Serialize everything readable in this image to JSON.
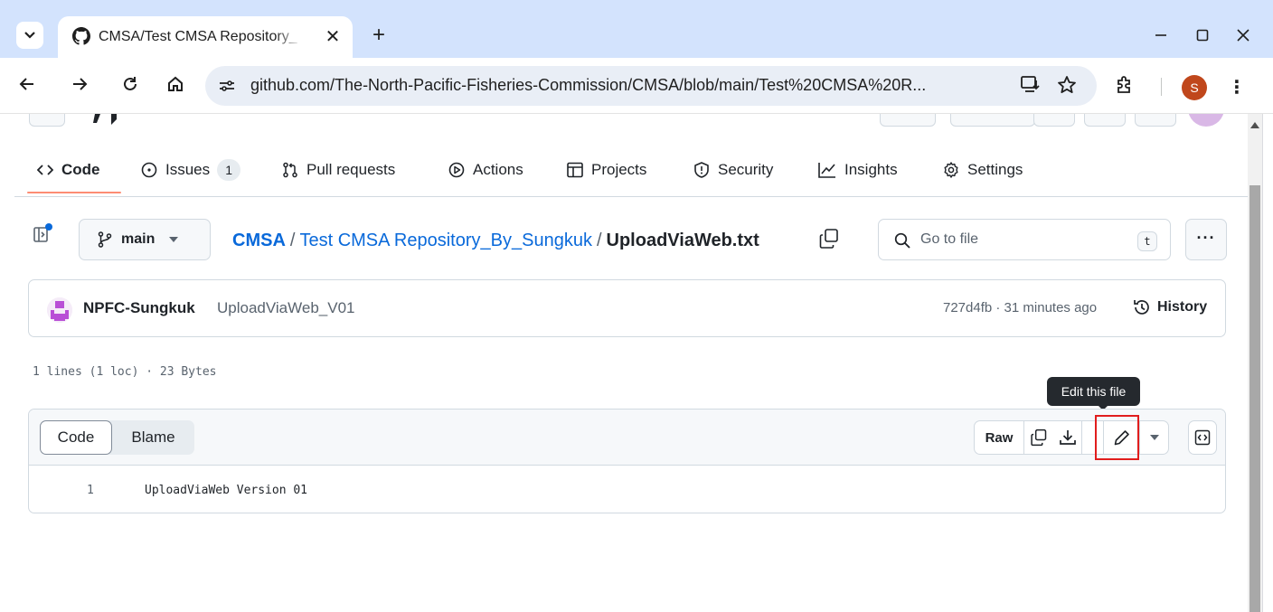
{
  "browser": {
    "tab_title": "CMSA/Test CMSA Repository_B",
    "url": "github.com/The-North-Pacific-Fisheries-Commission/CMSA/blob/main/Test%20CMSA%20R...",
    "profile_initial": "S"
  },
  "repo_nav": {
    "items": [
      {
        "label": "Code",
        "icon": "code-icon",
        "selected": true
      },
      {
        "label": "Issues",
        "icon": "issue-opened-icon",
        "count": "1"
      },
      {
        "label": "Pull requests",
        "icon": "pull-request-icon"
      },
      {
        "label": "Actions",
        "icon": "play-icon"
      },
      {
        "label": "Projects",
        "icon": "table-icon"
      },
      {
        "label": "Security",
        "icon": "shield-icon"
      },
      {
        "label": "Insights",
        "icon": "graph-icon"
      },
      {
        "label": "Settings",
        "icon": "gear-icon"
      }
    ]
  },
  "file_header": {
    "branch": "main",
    "breadcrumb": {
      "owner": "CMSA",
      "folder": "Test CMSA Repository_By_Sungkuk",
      "file": "UploadViaWeb.txt",
      "separator": "/"
    },
    "goto_placeholder": "Go to file",
    "goto_shortcut": "t"
  },
  "commit": {
    "author": "NPFC-Sungkuk",
    "message": "UploadViaWeb_V01",
    "meta": "727d4fb · 31 minutes ago",
    "history_label": "History"
  },
  "file_stats": "1 lines (1 loc) · 23 Bytes",
  "tooltip": "Edit this file",
  "file_view": {
    "tabs": [
      "Code",
      "Blame"
    ],
    "raw_label": "Raw",
    "lines": [
      {
        "number": "1",
        "text": "UploadViaWeb Version 01"
      }
    ]
  },
  "colors": {
    "tabbar_bg": "#d3e3fd",
    "link": "#0969da",
    "nav_underline": "#fd8c73",
    "highlight_box": "#e11d1d",
    "profile_bg": "#c0471c"
  }
}
